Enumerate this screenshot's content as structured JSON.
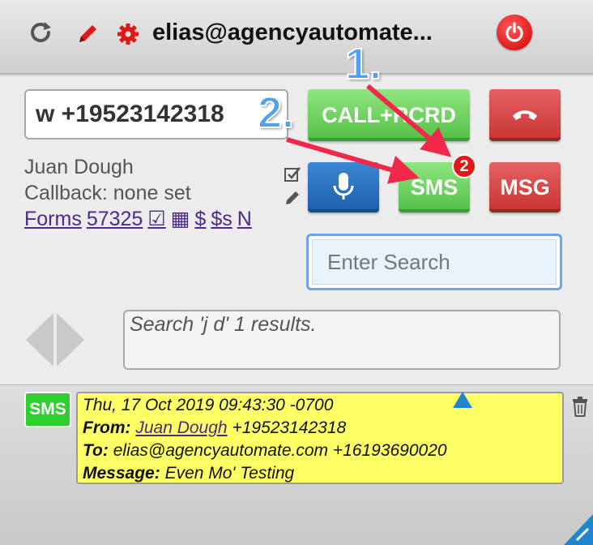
{
  "header": {
    "account": "elias@agencyautomate...",
    "icons": {
      "refresh": "refresh-icon",
      "edit": "pencil-icon",
      "settings": "gear-icon",
      "power": "power-icon"
    }
  },
  "dialer": {
    "phone_value": "w +19523142318",
    "call_label": "CALL+RCRD",
    "sms_label": "SMS",
    "msg_label": "MSG",
    "sms_badge_count": "2"
  },
  "contact": {
    "name": "Juan Dough",
    "callback": "Callback: none set",
    "links": [
      "Forms",
      "57325",
      "☑",
      "▦",
      "$",
      "$s",
      "N"
    ]
  },
  "search": {
    "placeholder": "Enter Search",
    "results_text": "Search 'j d' 1 results."
  },
  "message": {
    "type_badge": "SMS",
    "date": "Thu, 17 Oct 2019 09:43:30 -0700",
    "from_label": "From:",
    "from_name": "Juan Dough",
    "from_number": "+19523142318",
    "to_label": "To:",
    "to_value": "elias@agencyautomate.com +16193690020",
    "message_label": "Message:",
    "message_text": "Even Mo' Testing"
  },
  "annotations": {
    "step1": "1.",
    "step2": "2."
  },
  "colors": {
    "green": "#57c24a",
    "red": "#c93636",
    "blue": "#1e62ad",
    "message_bg": "#ffff66",
    "annotation_arrow": "#f2284a"
  }
}
